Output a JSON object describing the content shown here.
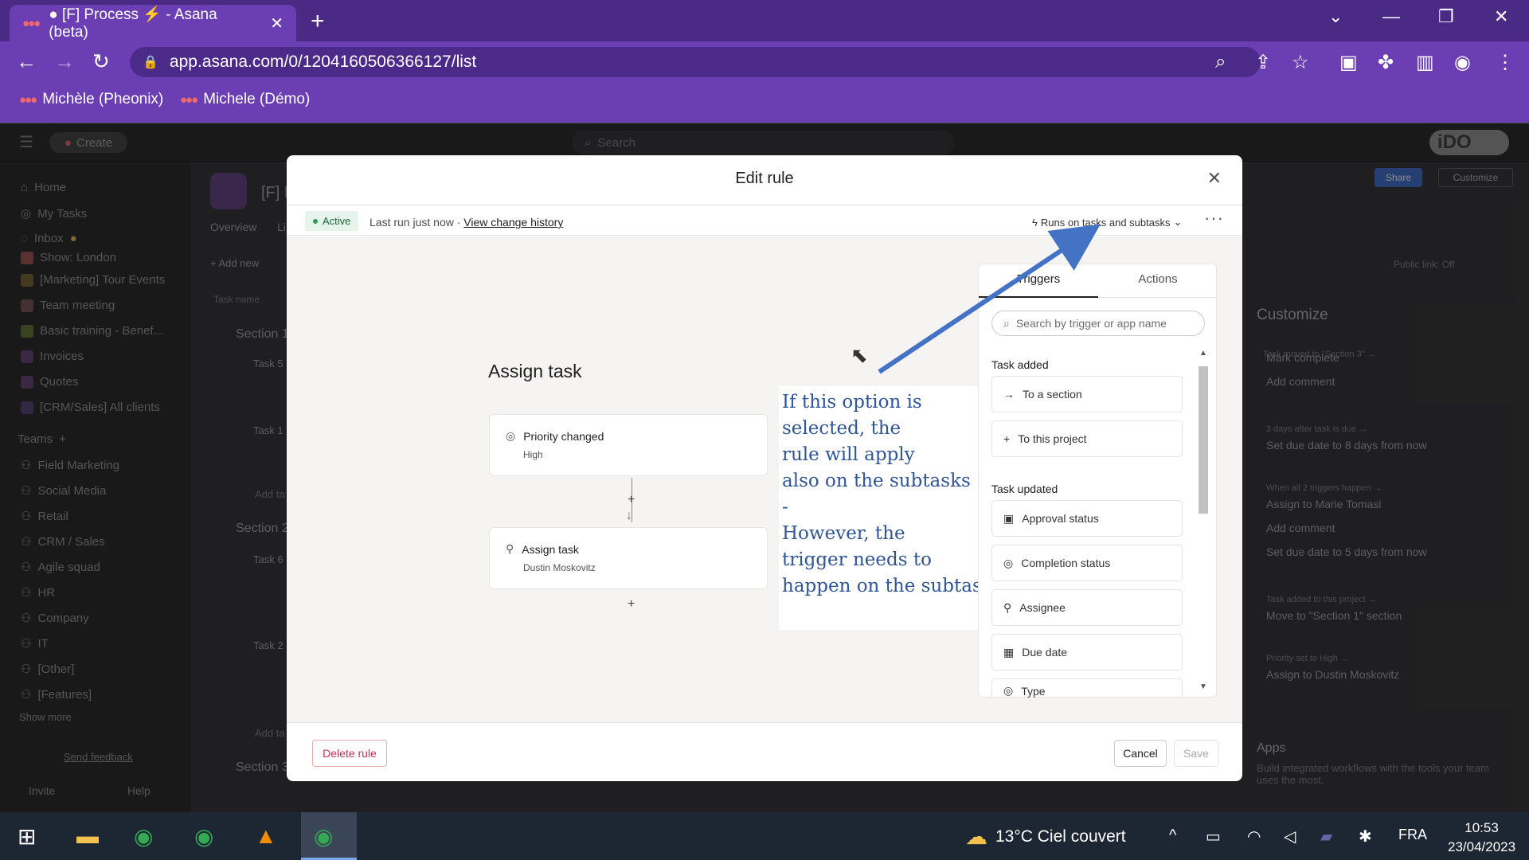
{
  "browser": {
    "tab_title": "● [F] Process ⚡ - Asana (beta)",
    "url": "app.asana.com/0/1204160506366127/list",
    "bookmarks": [
      "Michèle (Pheonix)",
      "Michele (Démo)"
    ]
  },
  "app": {
    "create_label": "Create",
    "search_placeholder": "Search",
    "logo_text": "iDO"
  },
  "sidebar": {
    "nav": [
      "Home",
      "My Tasks",
      "Inbox"
    ],
    "projects": [
      "Show: London",
      "[Marketing] Tour Events",
      "Team meeting",
      "Basic training - Benef...",
      "Invoices",
      "Quotes",
      "[CRM/Sales] All clients"
    ],
    "teams_label": "Teams",
    "teams": [
      "Field Marketing",
      "Social Media",
      "Retail",
      "CRM / Sales",
      "Agile squad",
      "HR",
      "Company",
      "IT",
      "[Other]",
      "[Features]"
    ],
    "show_more": "Show more",
    "send_feedback": "Send feedback",
    "invite": "Invite",
    "help": "Help"
  },
  "background": {
    "project_title": "[F] P",
    "tabs": [
      "Overview",
      "Li"
    ],
    "add_new": "+ Add new",
    "task_name_header": "Task name",
    "sections": [
      "Section 1",
      "Section 2",
      "Section 3"
    ],
    "tasks": [
      "Task 5",
      "Task 1",
      "Task 6",
      "Task 2"
    ],
    "add_task": "Add ta",
    "share": "Share",
    "customize_btn": "Customize",
    "public_link": "Public link: Off"
  },
  "customize_panel": {
    "title": "Customize",
    "rows": [
      {
        "label": "Task moved to \"Section 3\" →",
        "actions": [
          "Mark complete",
          "Add comment"
        ]
      },
      {
        "label": "3 days after task is due →",
        "actions": [
          "Set due date to 8 days from now"
        ]
      },
      {
        "label": "When all 2 triggers happen →",
        "actions": [
          "Assign to Marie Tomasi",
          "Add comment",
          "Set due date to 5 days from now"
        ]
      },
      {
        "label": "Task added to this project →",
        "actions": [
          "Move to \"Section 1\" section"
        ]
      },
      {
        "label": "Priority set to High →",
        "actions": [
          "Assign to Dustin Moskovitz"
        ]
      }
    ],
    "apps_title": "Apps",
    "apps_desc": "Build integrated workflows with the tools your team uses the most."
  },
  "modal": {
    "title": "Edit rule",
    "status": "Active",
    "last_run": "Last run just now · ",
    "change_history": "View change history",
    "runs_on": "Runs on tasks and subtasks",
    "rule_title": "Assign task",
    "trigger_card": {
      "title": "Priority changed",
      "sub": "High"
    },
    "action_card": {
      "title": "Assign task",
      "sub": "Dustin Moskovitz"
    },
    "annotation": [
      "If this option is",
      "selected, the",
      "rule will apply",
      "also on the subtasks",
      "-",
      "However, the",
      "trigger needs to",
      "happen on the subtask"
    ],
    "panel": {
      "tab_triggers": "Triggers",
      "tab_actions": "Actions",
      "search_placeholder": "Search by trigger or app name",
      "group_added": "Task added",
      "added_items": [
        "To a section",
        "To this project"
      ],
      "group_updated": "Task updated",
      "updated_items": [
        "Approval status",
        "Completion status",
        "Assignee",
        "Due date",
        "Type"
      ]
    },
    "delete_label": "Delete rule",
    "cancel_label": "Cancel",
    "save_label": "Save"
  },
  "taskbar": {
    "weather": "13°C  Ciel couvert",
    "lang": "FRA",
    "time": "10:53",
    "date": "23/04/2023"
  },
  "colors": {
    "browser_purple": "#6b3fb3",
    "annotation_blue": "#2f5597",
    "arrow_blue": "#4472c4",
    "danger": "#c92f54"
  }
}
